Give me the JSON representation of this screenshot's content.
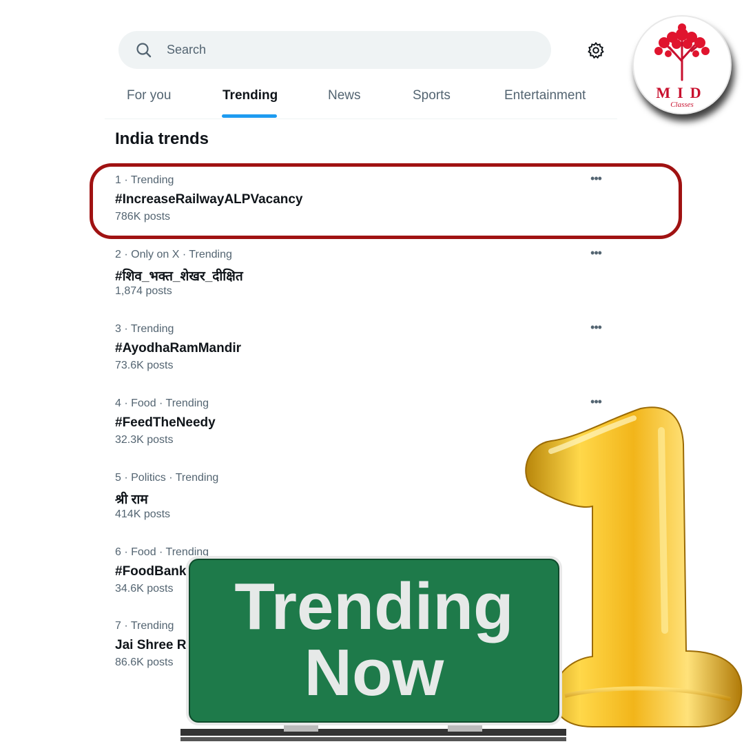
{
  "search": {
    "placeholder": "Search",
    "icon": "search-icon"
  },
  "settings": {
    "icon": "gear-icon"
  },
  "tabs": [
    {
      "label": "For you",
      "active": false
    },
    {
      "label": "Trending",
      "active": true
    },
    {
      "label": "News",
      "active": false
    },
    {
      "label": "Sports",
      "active": false
    },
    {
      "label": "Entertainment",
      "active": false
    }
  ],
  "section_title": "India trends",
  "trends": [
    {
      "meta": "1 · Trending",
      "tag": "#IncreaseRailwayALPVacancy",
      "count": "786K posts"
    },
    {
      "meta": "2 · Only on X · Trending",
      "tag": "#शिव_भक्त_शेखर_दीक्षित",
      "count": "1,874 posts"
    },
    {
      "meta": "3 · Trending",
      "tag": "#AyodhaRamMandir",
      "count": "73.6K posts"
    },
    {
      "meta": "4 · Food · Trending",
      "tag": "#FeedTheNeedy",
      "count": "32.3K posts"
    },
    {
      "meta": "5 · Politics · Trending",
      "tag": "श्री राम",
      "count": "414K posts"
    },
    {
      "meta": "6 · Food · Trending",
      "tag": "#FoodBank",
      "count": "34.6K posts"
    },
    {
      "meta": "7 · Trending",
      "tag": "Jai Shree Ra",
      "count": "86.6K posts"
    }
  ],
  "more_glyph": "•••",
  "logo": {
    "brand": "MID",
    "sub": "Classes"
  },
  "sign": {
    "line1": "Trending",
    "line2": "Now"
  },
  "colors": {
    "accent": "#1d9bf0",
    "highlight": "#a01212",
    "sign_green": "#1e7a4a",
    "gold": "#f2b51a",
    "brand_red": "#c8102e"
  }
}
